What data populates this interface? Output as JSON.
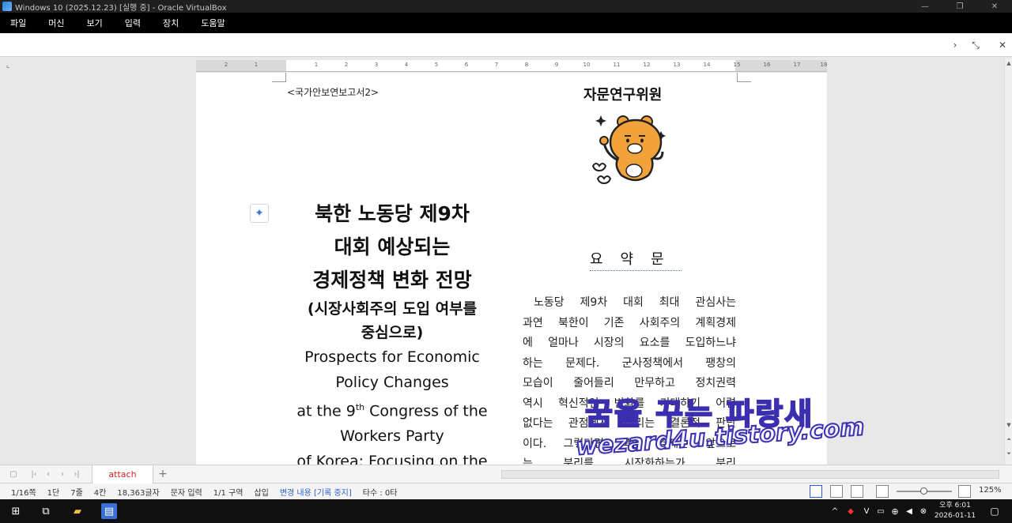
{
  "window": {
    "title": "Windows 10 (2025.12.23) [실행 중] - Oracle VirtualBox"
  },
  "menu": [
    "파일",
    "머신",
    "보기",
    "입력",
    "장치",
    "도움말"
  ],
  "ruler": {
    "labels": [
      "2",
      "1",
      "1",
      "2",
      "3",
      "4",
      "5",
      "6",
      "7",
      "8",
      "9",
      "10",
      "11",
      "12",
      "13",
      "14",
      "15",
      "16",
      "17",
      "18"
    ]
  },
  "document": {
    "header_left": "<국가안보연보고서2>",
    "header_right": "자문연구위원",
    "title_ko": [
      "북한 노동당 제9차",
      "대회 예상되는",
      "경제정책 변화 전망"
    ],
    "title_sub": [
      "(시장사회주의 도입 여부를",
      "중심으로)"
    ],
    "title_en_1": "Prospects for Economic",
    "title_en_2": "Policy Changes",
    "title_en_3_pre": "at the 9",
    "title_en_3_sup": "th",
    "title_en_3_post": " Congress of the",
    "title_en_4": "Workers Party",
    "title_en_5": "of Korea: Focusing on the",
    "summary_title": "요약문",
    "summary_lines": [
      "노동당 제9차 대회 최대 관심사는",
      "과연 북한이 기존 사회주의 계획경제",
      "에 얼마나 시장의 요소를 도입하느냐",
      "하는 문제다. 군사정책에서 팽창의",
      "모습이 줄어들리 만무하고 정치권력",
      "역시 혁신적인 변화를 기대하기 어렵",
      "없다는 관점에서 내리는 결론적 판단",
      "이다. 그렇다면 북한 경제는 앞으로",
      "는 분리를 시장화하는가 분리"
    ],
    "watermark_line1": "꿈을 꾸는 파랑새",
    "watermark_line2": "wezard4u.tistory.com"
  },
  "tabs": {
    "active": "attach"
  },
  "status": {
    "page": "1/16쪽",
    "column": "1단",
    "line": "7줄",
    "position": "4칸",
    "chars": "18,363글자",
    "mode": "문자 입력",
    "section": "1/1 구역",
    "insert": "삽입",
    "track": "변경 내용 [기록 중지]",
    "typing": "타수 : 0타",
    "zoom": "125%"
  },
  "taskbar": {
    "time": "오후 6:01",
    "date": "2026-01-11"
  },
  "colors": {
    "accent_blue": "#2a62c9",
    "watermark_stroke": "#3b2fb0",
    "tab_text": "#dd2222"
  }
}
